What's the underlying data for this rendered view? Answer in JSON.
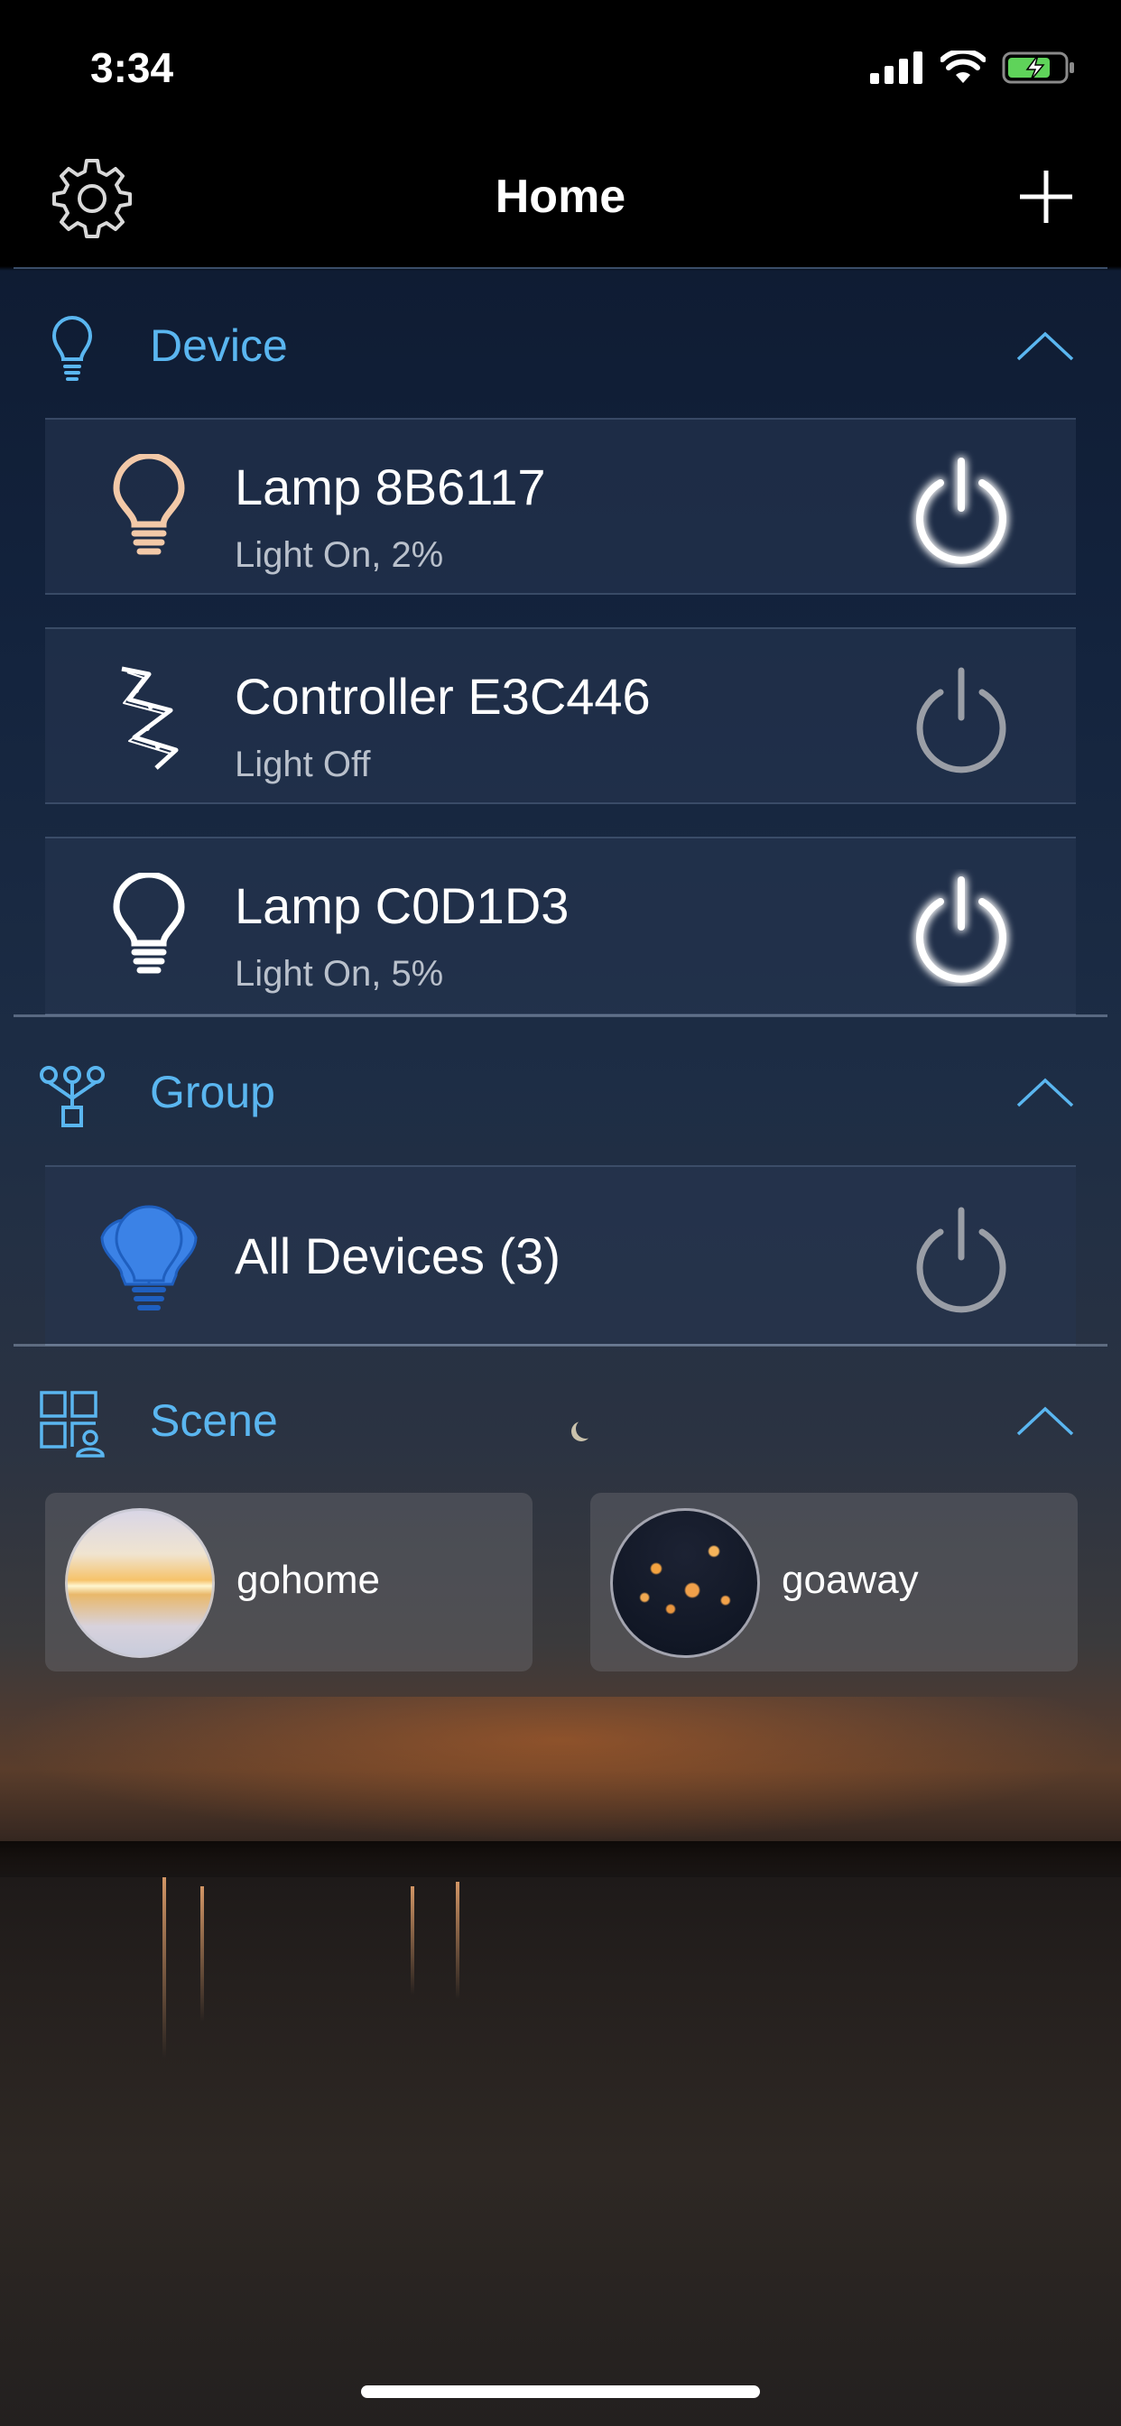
{
  "status_bar": {
    "time": "3:34"
  },
  "nav": {
    "title": "Home"
  },
  "sections": {
    "device": {
      "title": "Device",
      "items": [
        {
          "name": "Lamp 8B6117",
          "status": "Light On, 2%",
          "power": "on"
        },
        {
          "name": "Controller E3C446",
          "status": "Light Off",
          "power": "off"
        },
        {
          "name": "Lamp C0D1D3",
          "status": "Light On, 5%",
          "power": "on"
        }
      ]
    },
    "group": {
      "title": "Group",
      "items": [
        {
          "name": "All Devices (3)",
          "power": "off"
        }
      ]
    },
    "scene": {
      "title": "Scene",
      "items": [
        {
          "name": "gohome"
        },
        {
          "name": "goaway"
        }
      ]
    }
  },
  "colors": {
    "accent": "#5ab6f0",
    "text_primary": "#ffffff",
    "text_secondary": "#b9c0cb",
    "battery": "#5fd35a",
    "group_icon": "#3b82e6"
  },
  "icons": {
    "settings": "gear-icon",
    "add": "plus-icon",
    "device_section": "lightbulb-outline-icon",
    "group_section": "group-nodes-icon",
    "scene_section": "scene-grid-icon",
    "collapse": "chevron-up-icon",
    "power": "power-icon"
  }
}
